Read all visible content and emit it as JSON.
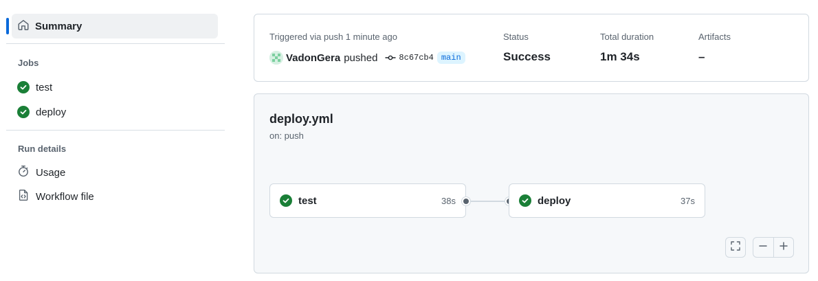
{
  "sidebar": {
    "summary_label": "Summary",
    "jobs_heading": "Jobs",
    "jobs": [
      {
        "label": "test",
        "status": "success"
      },
      {
        "label": "deploy",
        "status": "success"
      }
    ],
    "run_details_heading": "Run details",
    "details": [
      {
        "label": "Usage",
        "icon": "stopwatch-icon"
      },
      {
        "label": "Workflow file",
        "icon": "file-code-icon"
      }
    ]
  },
  "summary": {
    "trigger_text": "Triggered via push 1 minute ago",
    "actor": "VadonGera",
    "action": "pushed",
    "commit_sha": "8c67cb4",
    "branch": "main",
    "status_label": "Status",
    "status_value": "Success",
    "duration_label": "Total duration",
    "duration_value": "1m 34s",
    "artifacts_label": "Artifacts",
    "artifacts_value": "–"
  },
  "workflow": {
    "file_name": "deploy.yml",
    "trigger": "on: push",
    "jobs": [
      {
        "name": "test",
        "duration": "38s"
      },
      {
        "name": "deploy",
        "duration": "37s"
      }
    ]
  },
  "colors": {
    "success": "#1a7f37",
    "accent": "#0969da",
    "muted_text": "#59636e",
    "border": "#d1d9e0"
  }
}
